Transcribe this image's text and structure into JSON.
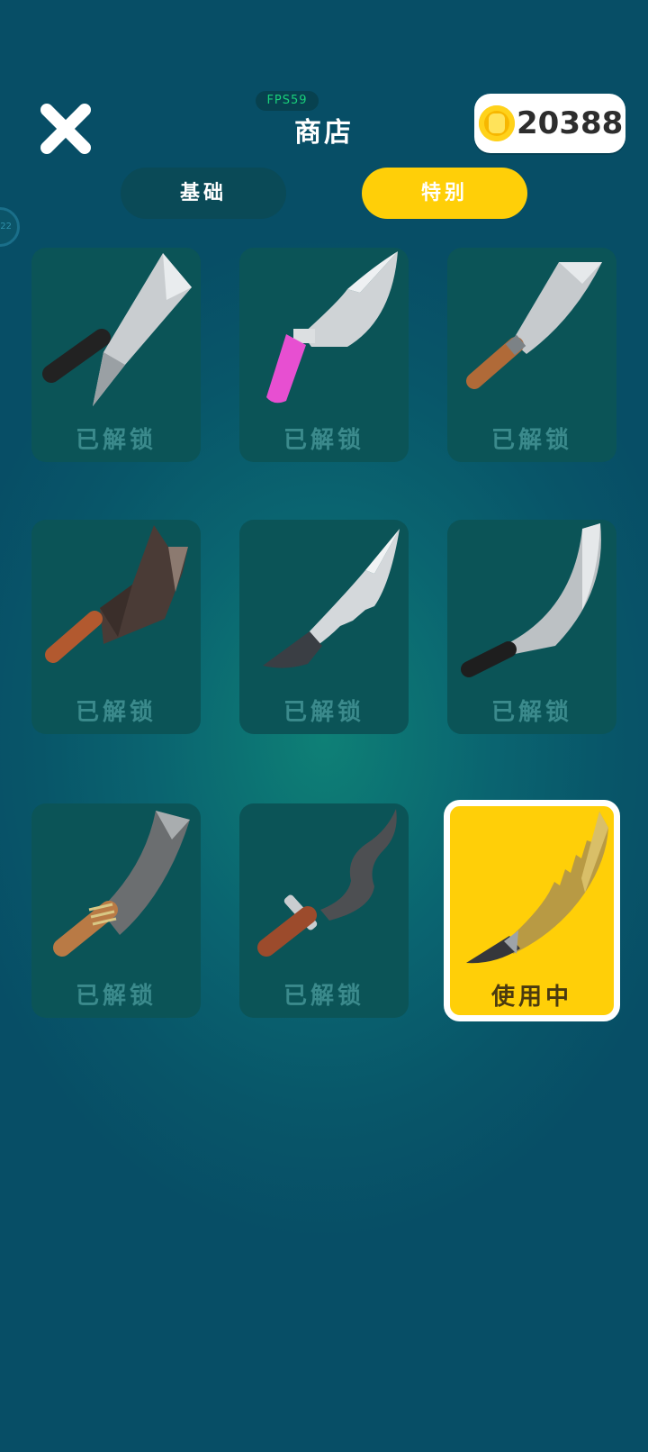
{
  "header": {
    "fps_label": "FPS59",
    "title": "商店",
    "coins": "20388"
  },
  "tabs": [
    {
      "label": "基础",
      "selected": false
    },
    {
      "label": "特别",
      "selected": true
    }
  ],
  "side_badge_text": "22",
  "colors": {
    "accent_yellow": "#ffcf08",
    "card_bg": "#0b5457",
    "status_text": "#3b8a8c"
  },
  "items": [
    {
      "name": "cleaver",
      "status": "已解锁",
      "in_use": false
    },
    {
      "name": "pink-handle-knife",
      "status": "已解锁",
      "in_use": false
    },
    {
      "name": "chef-knife",
      "status": "已解锁",
      "in_use": false
    },
    {
      "name": "hook-cleaver",
      "status": "已解锁",
      "in_use": false
    },
    {
      "name": "tactical-knife",
      "status": "已解锁",
      "in_use": false
    },
    {
      "name": "curved-blade",
      "status": "已解锁",
      "in_use": false
    },
    {
      "name": "machete",
      "status": "已解锁",
      "in_use": false
    },
    {
      "name": "kris-dagger",
      "status": "已解锁",
      "in_use": false
    },
    {
      "name": "golden-saw-blade",
      "status": "使用中",
      "in_use": true
    }
  ]
}
